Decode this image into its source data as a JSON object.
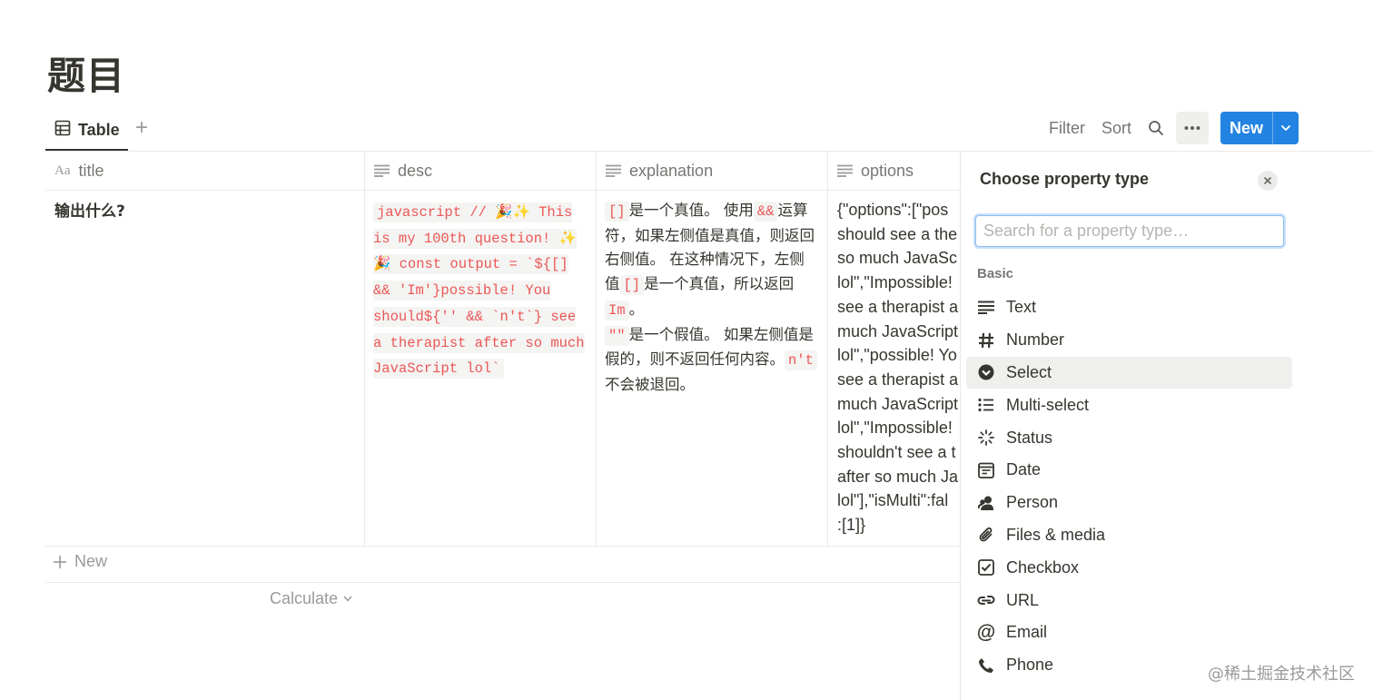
{
  "page": {
    "title": "题目"
  },
  "viewbar": {
    "tab_label": "Table",
    "filter": "Filter",
    "sort": "Sort",
    "new_label": "New"
  },
  "columns": [
    {
      "label": "title",
      "icon": "text-aa-icon"
    },
    {
      "label": "desc",
      "icon": "text-lines-icon"
    },
    {
      "label": "explanation",
      "icon": "text-lines-icon"
    },
    {
      "label": "options",
      "icon": "text-lines-icon"
    }
  ],
  "row": {
    "title": "输出什么?",
    "desc": "javascript // 🎉✨ This is my 100th question! ✨🎉 const output = `${[] && 'Im'}possible! You should${'' && `n't`} see a therapist after so much JavaScript lol`",
    "explanation": {
      "code1": "[]",
      "text1": "是一个真值。 使用",
      "code2": "&&",
      "text2": "运算符，如果左侧值是真值，则返回右侧值。 在这种情况下，左侧值",
      "code3": "[]",
      "text3": "是一个真值，所以返回",
      "code4": "Im",
      "text4": "。",
      "code5": "\"\"",
      "text5": "是一个假值。 如果左侧值是假的，则不返回任何内容。",
      "code6": "n't",
      "text6": "不会被退回。"
    },
    "options_lines": [
      "{\"options\":[\"pos",
      "should see a the",
      "so much JavaSc",
      "lol\",\"Impossible!",
      "see a therapist a",
      "much JavaScript",
      "lol\",\"possible! Yo",
      "see a therapist a",
      "much JavaScript",
      "lol\",\"Impossible!",
      "shouldn't see a t",
      "after so much Ja",
      "lol\"],\"isMulti\":fal",
      ":[1]}"
    ]
  },
  "table_footer": {
    "new_row": "New",
    "calculate": "Calculate"
  },
  "panel": {
    "title": "Choose property type",
    "search_placeholder": "Search for a property type…",
    "section": "Basic",
    "items": [
      {
        "label": "Text",
        "icon": "text-lines-icon"
      },
      {
        "label": "Number",
        "icon": "hash-icon"
      },
      {
        "label": "Select",
        "icon": "select-chevron-circle-icon",
        "selected": true
      },
      {
        "label": "Multi-select",
        "icon": "bulleted-list-icon"
      },
      {
        "label": "Status",
        "icon": "status-spinner-icon"
      },
      {
        "label": "Date",
        "icon": "calendar-icon"
      },
      {
        "label": "Person",
        "icon": "person-icon"
      },
      {
        "label": "Files & media",
        "icon": "paperclip-icon"
      },
      {
        "label": "Checkbox",
        "icon": "checkbox-icon"
      },
      {
        "label": "URL",
        "icon": "link-icon"
      },
      {
        "label": "Email",
        "icon": "at-sign-icon"
      },
      {
        "label": "Phone",
        "icon": "phone-icon"
      }
    ]
  },
  "watermark": "@稀土掘金技术社区",
  "colors": {
    "accent": "#2383e2",
    "code_red": "#eb5757",
    "text": "#37352f",
    "muted": "#787774"
  }
}
